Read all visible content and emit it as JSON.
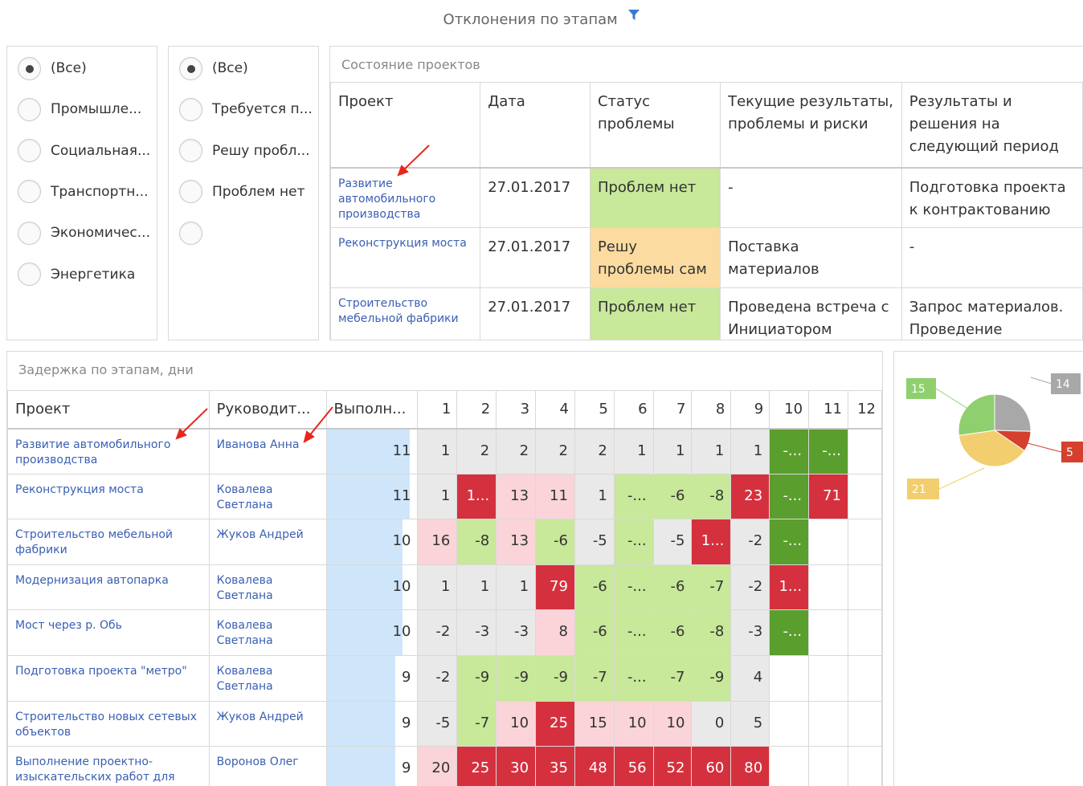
{
  "page": {
    "title": "Отклонения по этапам",
    "filter_icon": "filter-icon",
    "accent_color": "#3a78d6"
  },
  "filter_industry": {
    "options": [
      {
        "label": "(Все)",
        "checked": true
      },
      {
        "label": "Промышле...",
        "checked": false
      },
      {
        "label": "Социальная...",
        "checked": false
      },
      {
        "label": "Транспортн...",
        "checked": false
      },
      {
        "label": "Экономичес...",
        "checked": false
      },
      {
        "label": "Энергетика",
        "checked": false
      }
    ]
  },
  "filter_status": {
    "options": [
      {
        "label": "(Все)",
        "checked": true
      },
      {
        "label": "Требуется п...",
        "checked": false
      },
      {
        "label": "Решу пробл...",
        "checked": false
      },
      {
        "label": "Проблем нет",
        "checked": false
      },
      {
        "label": "",
        "checked": false
      }
    ]
  },
  "status_table": {
    "caption": "Состояние проектов",
    "headers": [
      "Проект",
      "Дата",
      "Статус проблемы",
      "Текущие результаты, проблемы и риски",
      "Результаты и решения на следующий период"
    ],
    "rows": [
      {
        "project": "Развитие автомобильного производства",
        "date": "27.01.2017",
        "status": "Проблем нет",
        "status_kind": "ok",
        "current": "-",
        "next": "Подготовка проекта к контрактованию"
      },
      {
        "project": "Реконструкция моста",
        "date": "27.01.2017",
        "status": "Решу проблемы сам",
        "status_kind": "warn",
        "current": "Поставка материалов",
        "next": "-"
      },
      {
        "project": "Строительство мебельной фабрики",
        "date": "27.01.2017",
        "status": "Проблем нет",
        "status_kind": "ok",
        "current": "Проведена встреча с Инициатором",
        "next": "Запрос материалов. Проведение"
      }
    ],
    "status_colors": {
      "ok": "#c8e89a",
      "warn": "#fcdba0"
    }
  },
  "delay_table": {
    "caption": "Задержка по этапам, дни",
    "headers": [
      "Проект",
      "Руководит...",
      "Выполн...",
      "1",
      "2",
      "3",
      "4",
      "5",
      "6",
      "7",
      "8",
      "9",
      "10",
      "11",
      "12"
    ],
    "max_done": 11,
    "rows": [
      {
        "project": "Развитие автомобильного производства",
        "manager": "Иванова Анна",
        "done": 11,
        "cells": [
          [
            "1",
            "gray"
          ],
          [
            "2",
            "gray"
          ],
          [
            "2",
            "gray"
          ],
          [
            "2",
            "gray"
          ],
          [
            "2",
            "gray"
          ],
          [
            "1",
            "gray"
          ],
          [
            "1",
            "gray"
          ],
          [
            "1",
            "gray"
          ],
          [
            "1",
            "gray"
          ],
          [
            "-...",
            "dgreen"
          ],
          [
            "-...",
            "dgreen"
          ],
          [
            "",
            "none"
          ]
        ]
      },
      {
        "project": "Реконструкция моста",
        "manager": "Ковалева Светлана",
        "done": 11,
        "cells": [
          [
            "1",
            "gray"
          ],
          [
            "1...",
            "red"
          ],
          [
            "13",
            "pink"
          ],
          [
            "11",
            "pink"
          ],
          [
            "1",
            "gray"
          ],
          [
            "-...",
            "lgreen"
          ],
          [
            "-6",
            "lgreen"
          ],
          [
            "-8",
            "lgreen"
          ],
          [
            "23",
            "red"
          ],
          [
            "-...",
            "dgreen"
          ],
          [
            "71",
            "red"
          ],
          [
            "",
            "none"
          ]
        ]
      },
      {
        "project": "Строительство мебельной фабрики",
        "manager": "Жуков Андрей",
        "done": 10,
        "cells": [
          [
            "16",
            "pink"
          ],
          [
            "-8",
            "lgreen"
          ],
          [
            "13",
            "pink"
          ],
          [
            "-6",
            "lgreen"
          ],
          [
            "-5",
            "gray"
          ],
          [
            "-...",
            "lgreen"
          ],
          [
            "-5",
            "gray"
          ],
          [
            "1...",
            "red"
          ],
          [
            "-2",
            "gray"
          ],
          [
            "-...",
            "dgreen"
          ],
          [
            "",
            "none"
          ],
          [
            "",
            "none"
          ]
        ]
      },
      {
        "project": "Модернизация автопарка",
        "manager": "Ковалева Светлана",
        "done": 10,
        "cells": [
          [
            "1",
            "gray"
          ],
          [
            "1",
            "gray"
          ],
          [
            "1",
            "gray"
          ],
          [
            "79",
            "red"
          ],
          [
            "-6",
            "lgreen"
          ],
          [
            "-...",
            "lgreen"
          ],
          [
            "-6",
            "lgreen"
          ],
          [
            "-7",
            "lgreen"
          ],
          [
            "-2",
            "gray"
          ],
          [
            "1...",
            "red"
          ],
          [
            "",
            "none"
          ],
          [
            "",
            "none"
          ]
        ]
      },
      {
        "project": "Мост через р. Обь",
        "manager": "Ковалева Светлана",
        "done": 10,
        "cells": [
          [
            "-2",
            "gray"
          ],
          [
            "-3",
            "gray"
          ],
          [
            "-3",
            "gray"
          ],
          [
            "8",
            "pink"
          ],
          [
            "-6",
            "lgreen"
          ],
          [
            "-...",
            "lgreen"
          ],
          [
            "-6",
            "lgreen"
          ],
          [
            "-8",
            "lgreen"
          ],
          [
            "-3",
            "gray"
          ],
          [
            "-...",
            "dgreen"
          ],
          [
            "",
            "none"
          ],
          [
            "",
            "none"
          ]
        ]
      },
      {
        "project": "Подготовка проекта \"метро\"",
        "manager": "Ковалева Светлана",
        "done": 9,
        "cells": [
          [
            "-2",
            "gray"
          ],
          [
            "-9",
            "lgreen"
          ],
          [
            "-9",
            "lgreen"
          ],
          [
            "-9",
            "lgreen"
          ],
          [
            "-7",
            "lgreen"
          ],
          [
            "-...",
            "lgreen"
          ],
          [
            "-7",
            "lgreen"
          ],
          [
            "-9",
            "lgreen"
          ],
          [
            "4",
            "gray"
          ],
          [
            "",
            "none"
          ],
          [
            "",
            "none"
          ],
          [
            "",
            "none"
          ]
        ]
      },
      {
        "project": "Строительство новых сетевых объектов",
        "manager": "Жуков Андрей",
        "done": 9,
        "cells": [
          [
            "-5",
            "gray"
          ],
          [
            "-7",
            "lgreen"
          ],
          [
            "10",
            "pink"
          ],
          [
            "25",
            "red"
          ],
          [
            "15",
            "pink"
          ],
          [
            "10",
            "pink"
          ],
          [
            "10",
            "pink"
          ],
          [
            "0",
            "gray"
          ],
          [
            "5",
            "gray"
          ],
          [
            "",
            "none"
          ],
          [
            "",
            "none"
          ],
          [
            "",
            "none"
          ]
        ]
      },
      {
        "project": "Выполнение проектно-изыскательских работ для ТЭЦ",
        "manager": "Воронов Олег",
        "done": 9,
        "cells": [
          [
            "20",
            "pink"
          ],
          [
            "25",
            "red"
          ],
          [
            "30",
            "red"
          ],
          [
            "35",
            "red"
          ],
          [
            "48",
            "red"
          ],
          [
            "56",
            "red"
          ],
          [
            "52",
            "red"
          ],
          [
            "60",
            "red"
          ],
          [
            "80",
            "red"
          ],
          [
            "",
            "none"
          ],
          [
            "",
            "none"
          ],
          [
            "",
            "none"
          ]
        ]
      }
    ]
  },
  "chart_data": {
    "type": "pie",
    "title": "",
    "slices": [
      {
        "label": "14",
        "value": 14,
        "color": "#a8a8a8"
      },
      {
        "label": "5",
        "value": 5,
        "color": "#d5402e"
      },
      {
        "label": "21",
        "value": 21,
        "color": "#f2ce6e"
      },
      {
        "label": "15",
        "value": 15,
        "color": "#8fcf6d"
      }
    ]
  }
}
